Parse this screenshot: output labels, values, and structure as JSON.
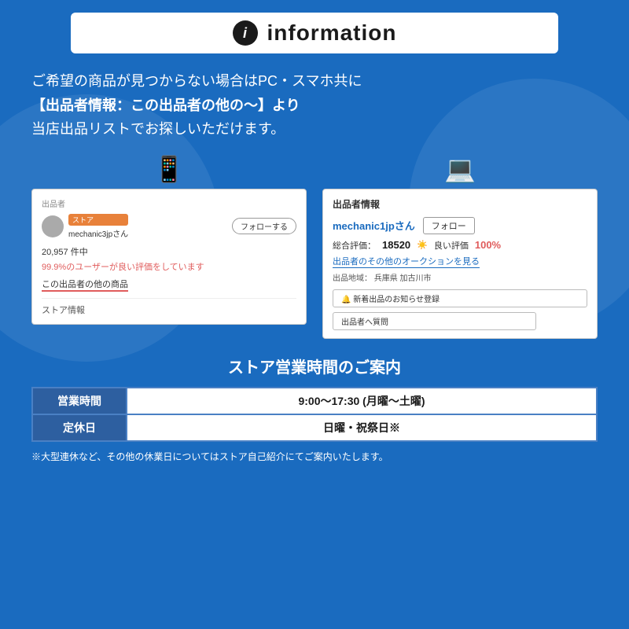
{
  "header": {
    "info_icon_text": "i",
    "title": "information"
  },
  "main_text": {
    "line1": "ご希望の商品が見つからない場合はPC・スマホ共に",
    "line2": "【出品者情報：この出品者の他の〜】より",
    "line3": "当店出品リストでお探しいただけます。"
  },
  "left_screenshot": {
    "section_label": "出品者",
    "store_badge": "ストア",
    "seller_name": "mechanic3jpさん",
    "follow_button": "フォローする",
    "review_count": "20,957 件中",
    "review_percent": "99.9%のユーザーが良い評価をしています",
    "other_products": "この出品者の他の商品",
    "store_info": "ストア情報"
  },
  "right_screenshot": {
    "section_label": "出品者情報",
    "seller_name": "mechanic1jpさん",
    "follow_button": "フォロー",
    "total_rating_label": "総合評価：",
    "total_rating_num": "18520",
    "good_rating_label": "良い評価",
    "good_rating_percent": "100%",
    "auction_link": "出品者のその他のオークションを見る",
    "location_label": "出品地域：",
    "location_value": "兵庫県 加古川市",
    "notification_btn": "🔔 新着出品のお知らせ登録",
    "question_btn": "出品者へ質問"
  },
  "store_hours": {
    "title": "ストア営業時間のご案内",
    "rows": [
      {
        "label": "営業時間",
        "value": "9:00〜17:30 (月曜〜土曜)"
      },
      {
        "label": "定休日",
        "value": "日曜・祝祭日※"
      }
    ],
    "footer_note": "※大型連休など、その他の休業日についてはストア自己紹介にてご案内いたします。"
  }
}
